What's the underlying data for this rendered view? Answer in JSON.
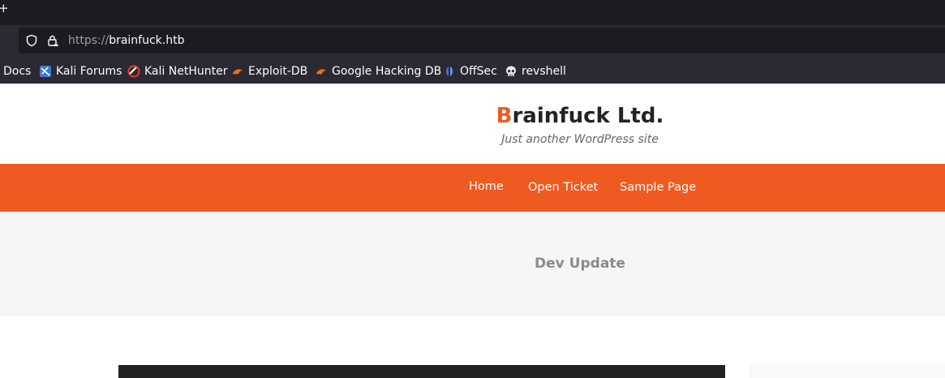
{
  "browser": {
    "url_scheme": "https://",
    "url_host": "brainfuck.htb",
    "bookmarks": [
      {
        "label": "Docs",
        "icon": "none"
      },
      {
        "label": "Kali Forums",
        "icon": "kali-forums-icon"
      },
      {
        "label": "Kali NetHunter",
        "icon": "nethunter-icon"
      },
      {
        "label": "Exploit-DB",
        "icon": "exploitdb-icon"
      },
      {
        "label": "Google Hacking DB",
        "icon": "ghdb-icon"
      },
      {
        "label": "OffSec",
        "icon": "offsec-icon"
      },
      {
        "label": "revshell",
        "icon": "skull-icon"
      }
    ]
  },
  "site": {
    "title_first": "B",
    "title_rest": "rainfuck Ltd.",
    "tagline": "Just another WordPress site",
    "accent_color": "#ef5a21",
    "menu": [
      "Home",
      "Open Ticket",
      "Sample Page"
    ],
    "page_title": "Dev Update"
  }
}
